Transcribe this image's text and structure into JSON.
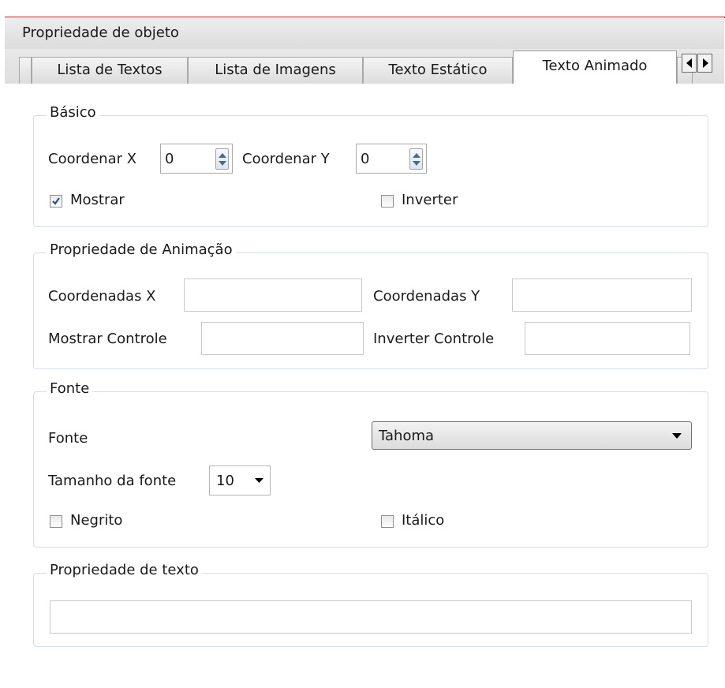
{
  "window": {
    "title": "Propriedade de objeto"
  },
  "tabs": [
    {
      "label": "Lista de Textos",
      "active": false
    },
    {
      "label": "Lista de Imagens",
      "active": false
    },
    {
      "label": "Texto Estático",
      "active": false
    },
    {
      "label": "Texto Animado",
      "active": true
    }
  ],
  "basic": {
    "title": "Básico",
    "x_label": "Coordenar X",
    "x_value": "0",
    "y_label": "Coordenar Y",
    "y_value": "0",
    "show_label": "Mostrar",
    "show_checked": true,
    "invert_label": "Inverter",
    "invert_checked": false
  },
  "animation": {
    "title": "Propriedade de Animação",
    "coords_x_label": "Coordenadas X",
    "coords_x_value": "",
    "coords_y_label": "Coordenadas Y",
    "coords_y_value": "",
    "show_control_label": "Mostrar Controle",
    "show_control_value": "",
    "invert_control_label": "Inverter Controle",
    "invert_control_value": ""
  },
  "font": {
    "title": "Fonte",
    "font_label": "Fonte",
    "font_value": "Tahoma",
    "size_label": "Tamanho da fonte",
    "size_value": "10",
    "bold_label": "Negrito",
    "bold_checked": false,
    "italic_label": "Itálico",
    "italic_checked": false
  },
  "text": {
    "title": "Propriedade de texto",
    "value": ""
  },
  "colors": {
    "window_border": "#d42020",
    "group_border": "#d5dfe5",
    "check_mark": "#2a4f9a"
  }
}
